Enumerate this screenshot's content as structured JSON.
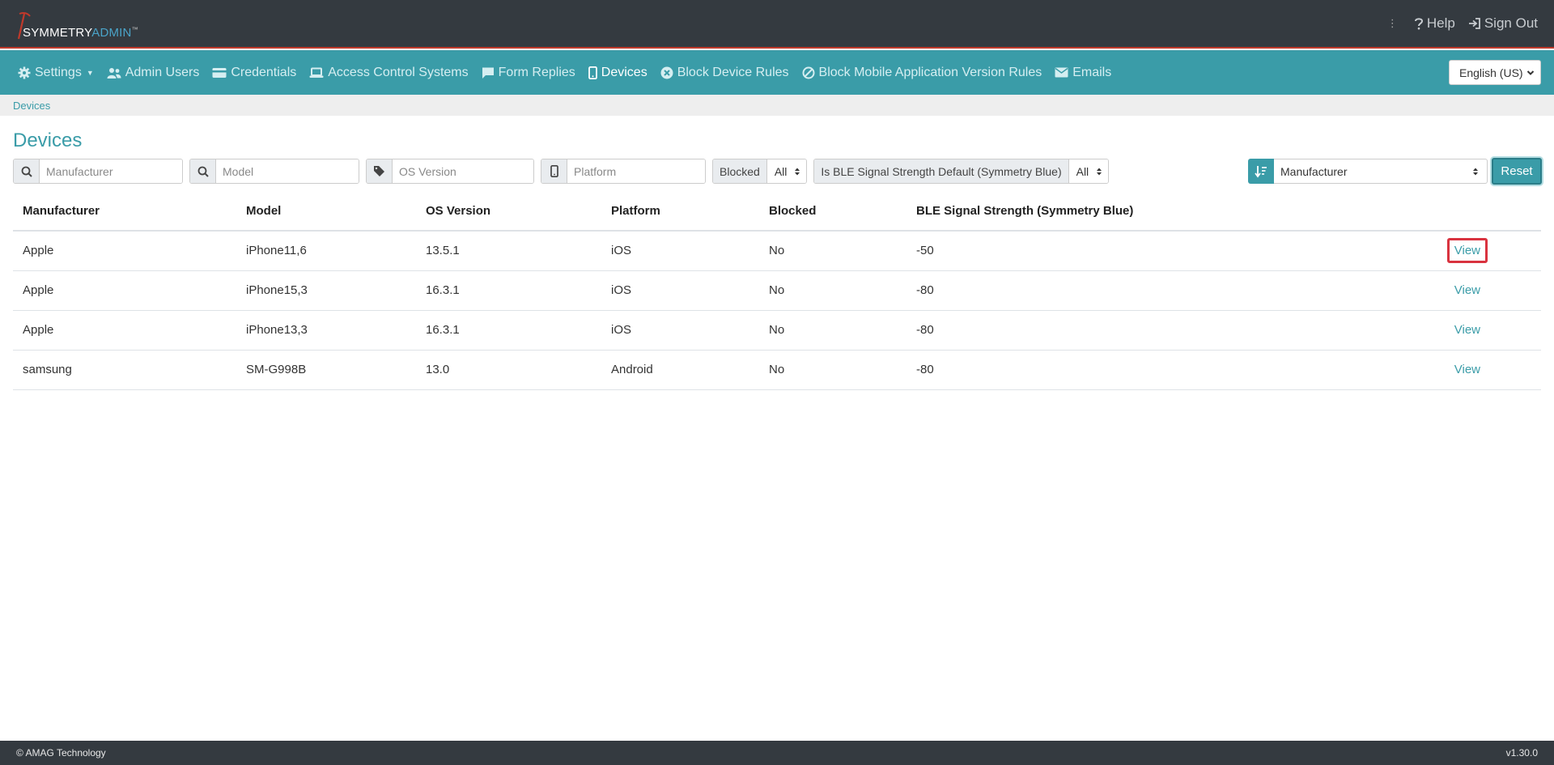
{
  "header": {
    "logo_primary": "SYMMETRY",
    "logo_secondary": "ADMIN",
    "logo_tm": "™",
    "more_glyph": "⋮",
    "help_label": "Help",
    "signout_label": "Sign Out"
  },
  "nav": {
    "items": [
      {
        "label": "Settings",
        "icon": "gear-icon"
      },
      {
        "label": "Admin Users",
        "icon": "users-icon"
      },
      {
        "label": "Credentials",
        "icon": "card-icon"
      },
      {
        "label": "Access Control Systems",
        "icon": "laptop-icon"
      },
      {
        "label": "Form Replies",
        "icon": "comment-icon"
      },
      {
        "label": "Devices",
        "icon": "mobile-icon"
      },
      {
        "label": "Block Device Rules",
        "icon": "x-circle-icon"
      },
      {
        "label": "Block Mobile Application Version Rules",
        "icon": "ban-icon"
      },
      {
        "label": "Emails",
        "icon": "envelope-icon"
      }
    ],
    "active": "Devices",
    "language": "English (US)"
  },
  "breadcrumb": {
    "current": "Devices"
  },
  "page": {
    "title": "Devices"
  },
  "filters": {
    "manufacturer_placeholder": "Manufacturer",
    "model_placeholder": "Model",
    "os_version_placeholder": "OS Version",
    "platform_placeholder": "Platform",
    "blocked_label": "Blocked",
    "blocked_value": "All",
    "ble_default_label": "Is BLE Signal Strength Default (Symmetry Blue)",
    "ble_default_value": "All",
    "sort_value": "Manufacturer",
    "reset_label": "Reset"
  },
  "table": {
    "headers": [
      "Manufacturer",
      "Model",
      "OS Version",
      "Platform",
      "Blocked",
      "BLE Signal Strength (Symmetry Blue)"
    ],
    "view_label": "View",
    "rows": [
      {
        "manufacturer": "Apple",
        "model": "iPhone11,6",
        "os_version": "13.5.1",
        "platform": "iOS",
        "blocked": "No",
        "ble": "-50"
      },
      {
        "manufacturer": "Apple",
        "model": "iPhone15,3",
        "os_version": "16.3.1",
        "platform": "iOS",
        "blocked": "No",
        "ble": "-80"
      },
      {
        "manufacturer": "Apple",
        "model": "iPhone13,3",
        "os_version": "16.3.1",
        "platform": "iOS",
        "blocked": "No",
        "ble": "-80"
      },
      {
        "manufacturer": "samsung",
        "model": "SM-G998B",
        "os_version": "13.0",
        "platform": "Android",
        "blocked": "No",
        "ble": "-80"
      }
    ],
    "highlighted_row": 0
  },
  "footer": {
    "copyright": "© AMAG Technology",
    "version": "v1.30.0"
  },
  "colors": {
    "header_bg": "#343a40",
    "accent": "#3a9ca8",
    "header_border": "#c0392b",
    "highlight": "#d9333f"
  }
}
